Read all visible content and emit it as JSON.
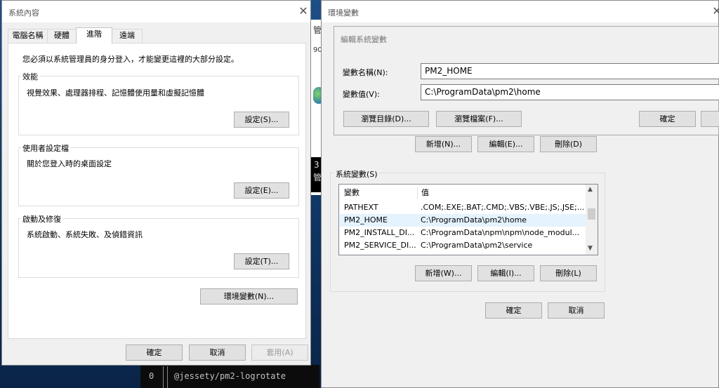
{
  "sys_props": {
    "title": "系統內容",
    "tabs": [
      {
        "label": "電腦名稱"
      },
      {
        "label": "硬體"
      },
      {
        "label": "進階"
      },
      {
        "label": "遠端"
      }
    ],
    "admin_note": "您必須以系統管理員的身分登入，才能變更這裡的大部分設定。",
    "performance": {
      "title": "效能",
      "desc": "視覺效果、處理器排程、記憶體使用量和虛擬記憶體",
      "button": "設定(S)..."
    },
    "user_profiles": {
      "title": "使用者設定檔",
      "desc": "關於您登入時的桌面設定",
      "button": "設定(E)..."
    },
    "startup_recovery": {
      "title": "啟動及修復",
      "desc": "系統啟動、系統失敗、及偵錯資訊",
      "button": "設定(T)..."
    },
    "env_button": "環境變數(N)...",
    "ok": "確定",
    "cancel": "取消",
    "apply": "套用(A)"
  },
  "env_vars": {
    "title": "環境變數",
    "user_buttons": {
      "new": "新增(N)...",
      "edit": "編輯(E)...",
      "delete": "刪除(D)"
    },
    "system_title": "系統變數(S)",
    "columns": {
      "name": "變數",
      "value": "值"
    },
    "rows": [
      {
        "name": "PATHEXT",
        "value": ".COM;.EXE;.BAT;.CMD;.VBS;.VBE;.JS;.JSE;..."
      },
      {
        "name": "PM2_HOME",
        "value": "C:\\ProgramData\\pm2\\home"
      },
      {
        "name": "PM2_INSTALL_DI...",
        "value": "C:\\ProgramData\\npm\\npm\\node_modul..."
      },
      {
        "name": "PM2_SERVICE_DI...",
        "value": "C:\\ProgramData\\pm2\\service"
      }
    ],
    "system_buttons": {
      "new": "新增(W)...",
      "edit": "編輯(I)...",
      "delete": "刪除(L)"
    },
    "ok": "確定",
    "cancel": "取消"
  },
  "edit_var": {
    "title": "編輯系統變數",
    "name_label": "變數名稱(N):",
    "name_value": "PM2_HOME",
    "value_label": "變數值(V):",
    "value_value": "C:\\ProgramData\\pm2\\home",
    "browse_dir": "瀏覽目錄(D)...",
    "browse_file": "瀏覽檔案(F)...",
    "ok": "確定"
  },
  "terminal": {
    "col0": "0",
    "text": "@jessety/pm2-logrotate"
  },
  "background_glimpses": {
    "g1": "管",
    "g2": "90",
    "g3": "3",
    "g4": "管"
  },
  "colors": {
    "desktop": "#0f3a6b",
    "dialog_bg": "#f0f0f0",
    "selection": "#e5f3ff",
    "terminal_bg": "#0c0c0c"
  }
}
